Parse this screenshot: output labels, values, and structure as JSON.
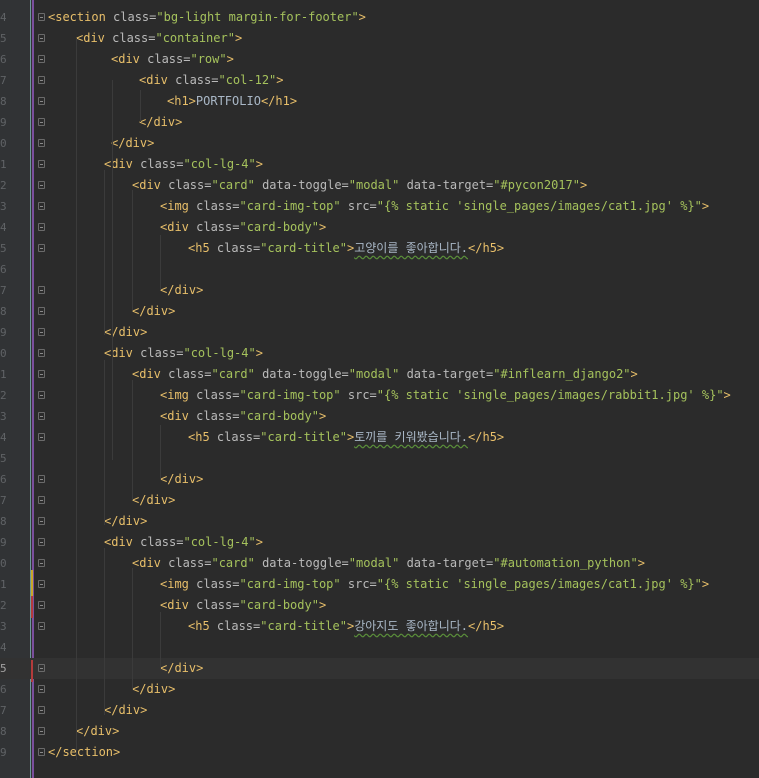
{
  "editor": {
    "language": "html-django",
    "colors": {
      "background": "#2b2b2b",
      "tag": "#e8bf6a",
      "attribute": "#bababa",
      "value": "#a5c25c",
      "text": "#a9b7c6",
      "gutter": "#313335"
    },
    "lines": [
      {
        "num": "4",
        "indent": 0,
        "segments": [
          [
            "tag",
            "<section"
          ],
          [
            "attr",
            " class="
          ],
          [
            "val",
            "\"bg-light margin-for-footer\""
          ],
          [
            "tag",
            ">"
          ]
        ]
      },
      {
        "num": "5",
        "indent": 28,
        "segments": [
          [
            "tag",
            "<div"
          ],
          [
            "attr",
            " class="
          ],
          [
            "val",
            "\"container\""
          ],
          [
            "tag",
            ">"
          ]
        ]
      },
      {
        "num": "6",
        "indent": 63,
        "segments": [
          [
            "tag",
            "<div"
          ],
          [
            "attr",
            " class="
          ],
          [
            "val",
            "\"row\""
          ],
          [
            "tag",
            ">"
          ]
        ]
      },
      {
        "num": "7",
        "indent": 91,
        "segments": [
          [
            "tag",
            "<div"
          ],
          [
            "attr",
            " class="
          ],
          [
            "val",
            "\"col-12\""
          ],
          [
            "tag",
            ">"
          ]
        ]
      },
      {
        "num": "8",
        "indent": 119,
        "segments": [
          [
            "tag",
            "<h1>"
          ],
          [
            "txt",
            "PORTFOLIO"
          ],
          [
            "tag",
            "</h1>"
          ]
        ]
      },
      {
        "num": "9",
        "indent": 91,
        "segments": [
          [
            "tag",
            "</div>"
          ]
        ]
      },
      {
        "num": "0",
        "indent": 63,
        "segments": [
          [
            "tag",
            "</div>"
          ]
        ]
      },
      {
        "num": "1",
        "indent": 56,
        "segments": [
          [
            "tag",
            "<div"
          ],
          [
            "attr",
            " class="
          ],
          [
            "val",
            "\"col-lg-4\""
          ],
          [
            "tag",
            ">"
          ]
        ]
      },
      {
        "num": "2",
        "indent": 84,
        "segments": [
          [
            "tag",
            "<div"
          ],
          [
            "attr",
            " class="
          ],
          [
            "val",
            "\"card\""
          ],
          [
            "attr",
            " data-toggle="
          ],
          [
            "val",
            "\"modal\""
          ],
          [
            "attr",
            " data-target="
          ],
          [
            "val",
            "\"#pycon2017\""
          ],
          [
            "tag",
            ">"
          ]
        ]
      },
      {
        "num": "3",
        "indent": 112,
        "segments": [
          [
            "tag",
            "<img"
          ],
          [
            "attr",
            " class="
          ],
          [
            "val",
            "\"card-img-top\""
          ],
          [
            "attr",
            " src="
          ],
          [
            "val",
            "\"{% static 'single_pages/images/cat1.jpg' %}\""
          ],
          [
            "tag",
            ">"
          ]
        ]
      },
      {
        "num": "4",
        "indent": 112,
        "segments": [
          [
            "tag",
            "<div"
          ],
          [
            "attr",
            " class="
          ],
          [
            "val",
            "\"card-body\""
          ],
          [
            "tag",
            ">"
          ]
        ]
      },
      {
        "num": "5",
        "indent": 140,
        "segments": [
          [
            "tag",
            "<h5"
          ],
          [
            "attr",
            " class="
          ],
          [
            "val",
            "\"card-title\""
          ],
          [
            "tag",
            ">"
          ],
          [
            "txt",
            "고양이를 좋아합니다."
          ],
          [
            "tag",
            "</h5>"
          ]
        ]
      },
      {
        "num": "6",
        "indent": 0,
        "segments": []
      },
      {
        "num": "7",
        "indent": 112,
        "segments": [
          [
            "tag",
            "</div>"
          ]
        ]
      },
      {
        "num": "8",
        "indent": 84,
        "segments": [
          [
            "tag",
            "</div>"
          ]
        ]
      },
      {
        "num": "9",
        "indent": 56,
        "segments": [
          [
            "tag",
            "</div>"
          ]
        ]
      },
      {
        "num": "0",
        "indent": 56,
        "segments": [
          [
            "tag",
            "<div"
          ],
          [
            "attr",
            " class="
          ],
          [
            "val",
            "\"col-lg-4\""
          ],
          [
            "tag",
            ">"
          ]
        ]
      },
      {
        "num": "1",
        "indent": 84,
        "segments": [
          [
            "tag",
            "<div"
          ],
          [
            "attr",
            " class="
          ],
          [
            "val",
            "\"card\""
          ],
          [
            "attr",
            " data-toggle="
          ],
          [
            "val",
            "\"modal\""
          ],
          [
            "attr",
            " data-target="
          ],
          [
            "val",
            "\"#inflearn_django2\""
          ],
          [
            "tag",
            ">"
          ]
        ]
      },
      {
        "num": "2",
        "indent": 112,
        "segments": [
          [
            "tag",
            "<img"
          ],
          [
            "attr",
            " class="
          ],
          [
            "val",
            "\"card-img-top\""
          ],
          [
            "attr",
            " src="
          ],
          [
            "val",
            "\"{% static 'single_pages/images/rabbit1.jpg' %}\""
          ],
          [
            "tag",
            ">"
          ]
        ]
      },
      {
        "num": "3",
        "indent": 112,
        "segments": [
          [
            "tag",
            "<div"
          ],
          [
            "attr",
            " class="
          ],
          [
            "val",
            "\"card-body\""
          ],
          [
            "tag",
            ">"
          ]
        ]
      },
      {
        "num": "4",
        "indent": 140,
        "segments": [
          [
            "tag",
            "<h5"
          ],
          [
            "attr",
            " class="
          ],
          [
            "val",
            "\"card-title\""
          ],
          [
            "tag",
            ">"
          ],
          [
            "txt",
            "토끼를 키워봤습니다."
          ],
          [
            "tag",
            "</h5>"
          ]
        ]
      },
      {
        "num": "5",
        "indent": 0,
        "segments": []
      },
      {
        "num": "6",
        "indent": 112,
        "segments": [
          [
            "tag",
            "</div>"
          ]
        ]
      },
      {
        "num": "7",
        "indent": 84,
        "segments": [
          [
            "tag",
            "</div>"
          ]
        ]
      },
      {
        "num": "8",
        "indent": 56,
        "segments": [
          [
            "tag",
            "</div>"
          ]
        ]
      },
      {
        "num": "9",
        "indent": 56,
        "segments": [
          [
            "tag",
            "<div"
          ],
          [
            "attr",
            " class="
          ],
          [
            "val",
            "\"col-lg-4\""
          ],
          [
            "tag",
            ">"
          ]
        ]
      },
      {
        "num": "0",
        "indent": 84,
        "segments": [
          [
            "tag",
            "<div"
          ],
          [
            "attr",
            " class="
          ],
          [
            "val",
            "\"card\""
          ],
          [
            "attr",
            " data-toggle="
          ],
          [
            "val",
            "\"modal\""
          ],
          [
            "attr",
            " data-target="
          ],
          [
            "val",
            "\"#automation_python\""
          ],
          [
            "tag",
            ">"
          ]
        ]
      },
      {
        "num": "1",
        "indent": 112,
        "segments": [
          [
            "tag",
            "<img"
          ],
          [
            "attr",
            " class="
          ],
          [
            "val",
            "\"card-img-top\""
          ],
          [
            "attr",
            " src="
          ],
          [
            "val",
            "\"{% static 'single_pages/images/cat1.jpg' %}\""
          ],
          [
            "tag",
            ">"
          ]
        ]
      },
      {
        "num": "2",
        "indent": 112,
        "segments": [
          [
            "tag",
            "<div"
          ],
          [
            "attr",
            " class="
          ],
          [
            "val",
            "\"card-body\""
          ],
          [
            "tag",
            ">"
          ]
        ]
      },
      {
        "num": "3",
        "indent": 140,
        "segments": [
          [
            "tag",
            "<h5"
          ],
          [
            "attr",
            " class="
          ],
          [
            "val",
            "\"card-title\""
          ],
          [
            "tag",
            ">"
          ],
          [
            "txt",
            "강아지도 좋아합니다."
          ],
          [
            "tag",
            "</h5>"
          ]
        ]
      },
      {
        "num": "4",
        "indent": 0,
        "segments": []
      },
      {
        "num": "5",
        "indent": 112,
        "segments": [
          [
            "tag",
            "</div>"
          ]
        ],
        "current": true
      },
      {
        "num": "6",
        "indent": 84,
        "segments": [
          [
            "tag",
            "</div>"
          ]
        ]
      },
      {
        "num": "7",
        "indent": 56,
        "segments": [
          [
            "tag",
            "</div>"
          ]
        ]
      },
      {
        "num": "8",
        "indent": 28,
        "segments": [
          [
            "tag",
            "</div>"
          ]
        ]
      },
      {
        "num": "9",
        "indent": 0,
        "segments": [
          [
            "tag",
            "</section>"
          ]
        ]
      }
    ]
  }
}
